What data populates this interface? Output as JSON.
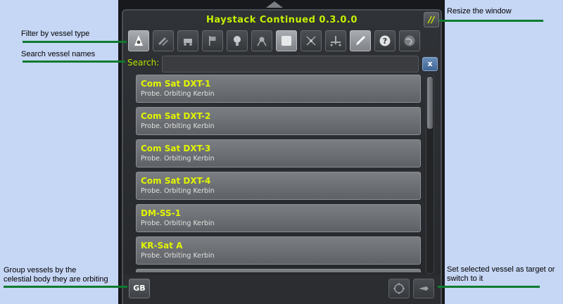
{
  "window": {
    "title": "Haystack Continued 0.3.0.0",
    "resize_label": "//"
  },
  "filters": [
    {
      "name": "filter-base",
      "icon": "base-icon"
    },
    {
      "name": "filter-debris",
      "icon": "debris-icon"
    },
    {
      "name": "filter-rover",
      "icon": "rover-icon"
    },
    {
      "name": "filter-flag",
      "icon": "flag-icon"
    },
    {
      "name": "filter-eva",
      "icon": "kerbal-icon"
    },
    {
      "name": "filter-lander",
      "icon": "lander-icon"
    },
    {
      "name": "filter-probe",
      "icon": "probe-icon"
    },
    {
      "name": "filter-relay",
      "icon": "relay-icon"
    },
    {
      "name": "filter-station",
      "icon": "station-icon"
    },
    {
      "name": "filter-ship",
      "icon": "ship-icon"
    },
    {
      "name": "filter-unknown",
      "icon": "question-icon"
    },
    {
      "name": "filter-planet",
      "icon": "planet-icon"
    }
  ],
  "search": {
    "label": "Search:",
    "value": "",
    "clear_label": "x"
  },
  "vessels": [
    {
      "name": "Com Sat DXT-1",
      "info": "Probe. Orbiting Kerbin"
    },
    {
      "name": "Com Sat DXT-2",
      "info": "Probe. Orbiting Kerbin"
    },
    {
      "name": "Com Sat DXT-3",
      "info": "Probe. Orbiting Kerbin"
    },
    {
      "name": "Com Sat DXT-4",
      "info": "Probe. Orbiting Kerbin"
    },
    {
      "name": "DM-SS-1",
      "info": "Probe. Orbiting Kerbin"
    },
    {
      "name": "KR-Sat A",
      "info": "Probe. Orbiting Kerbin"
    },
    {
      "name": "",
      "info": ""
    }
  ],
  "bottom": {
    "gb_label": "GB"
  },
  "annotations": {
    "resize": "Resize the window",
    "filter": "Filter by vessel type",
    "search": "Search vessel names",
    "group_line1": "Group vessels by the",
    "group_line2": "celestial body they are orbiting",
    "target_line1": "Set selected vessel as target or",
    "target_line2": "switch to it"
  }
}
